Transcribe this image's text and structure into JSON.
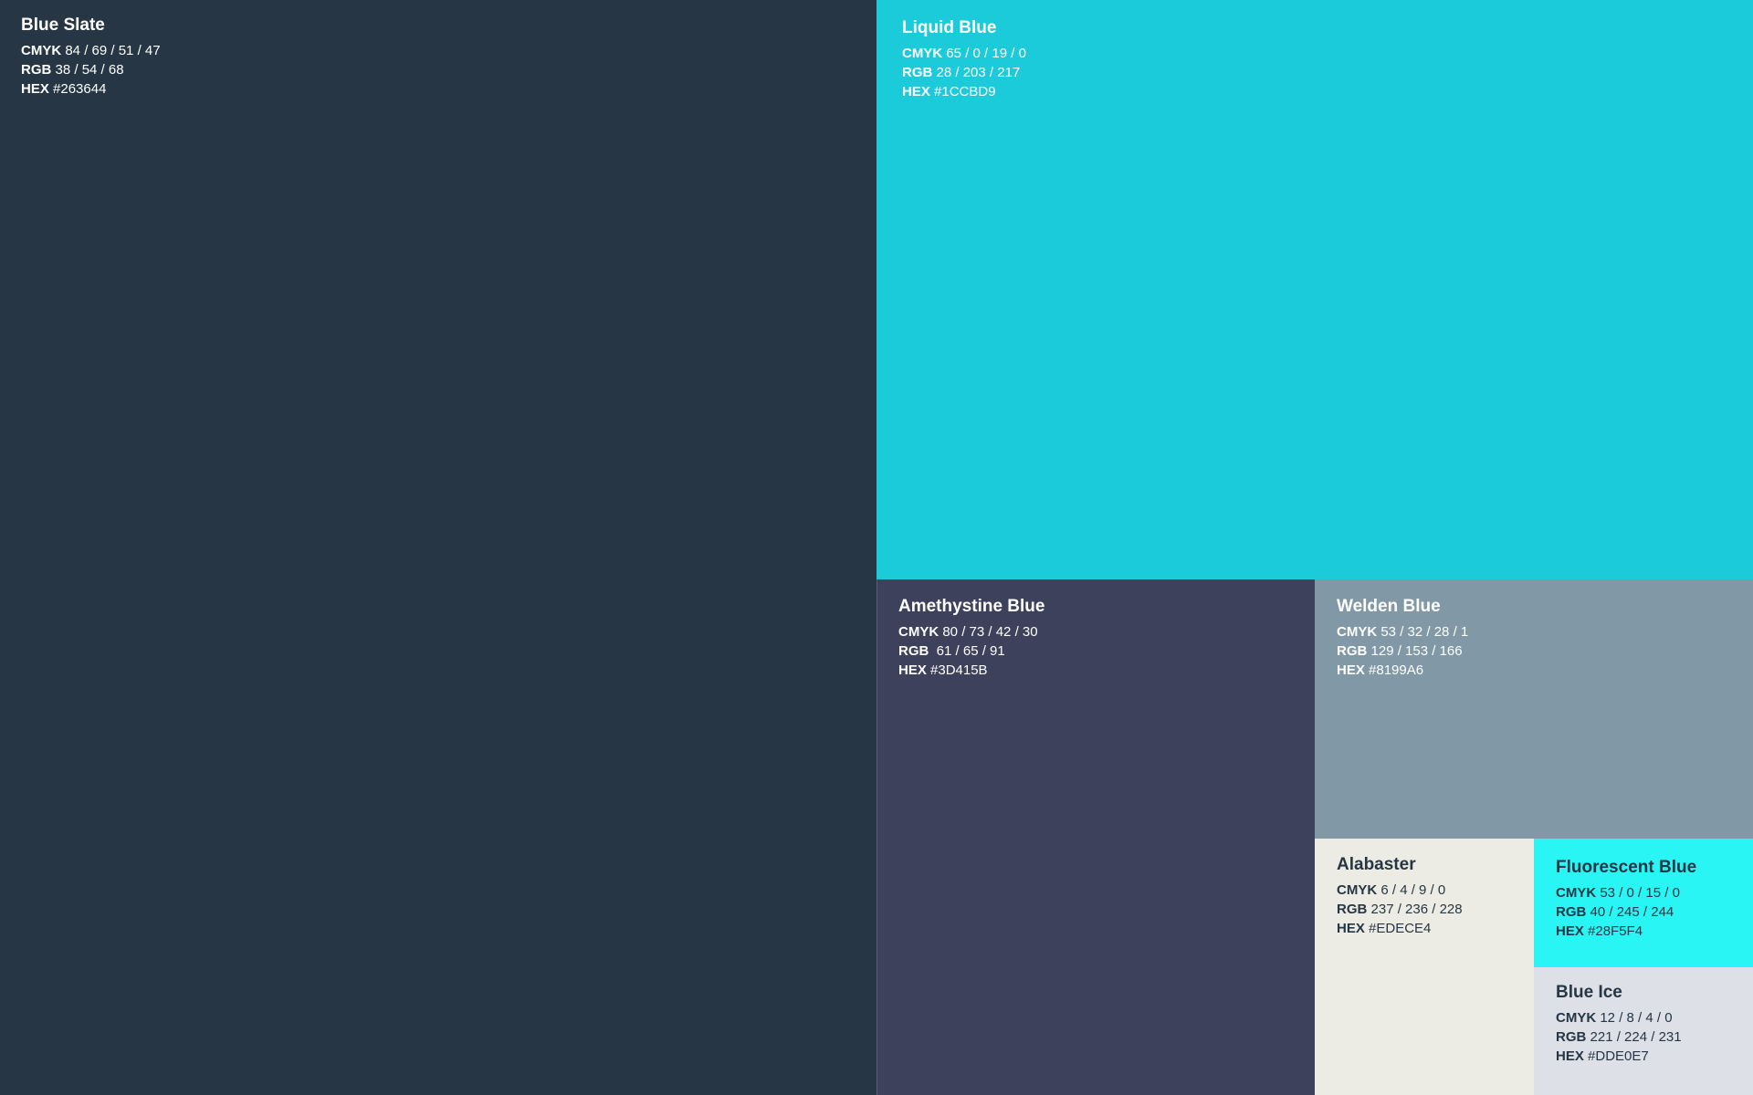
{
  "labels": {
    "cmyk": "CMYK",
    "rgb": "RGB",
    "hex": "HEX"
  },
  "swatches": [
    {
      "name": "Blue Slate",
      "cmyk": "84 / 69 / 51 / 47",
      "rgb": "38 / 54 / 68",
      "hex": "#263644",
      "color": "#263644",
      "text_color": "#ffffff"
    },
    {
      "name": "Liquid Blue",
      "cmyk": "65 / 0 / 19 / 0",
      "rgb": "28 / 203 / 217",
      "hex": "#1CCBD9",
      "color": "#1CCBD9",
      "text_color": "#ffffff"
    },
    {
      "name": "Amethystine Blue",
      "cmyk": "80 / 73 / 42 / 30",
      "rgb": " 61 / 65 / 91",
      "hex": "#3D415B",
      "color": "#3D415B",
      "text_color": "#ffffff"
    },
    {
      "name": "Welden Blue",
      "cmyk": "53 / 32 / 28 / 1",
      "rgb": "129 / 153 / 166",
      "hex": "#8199A6",
      "color": "#8199A6",
      "text_color": "#ffffff"
    },
    {
      "name": "Alabaster",
      "cmyk": "6 / 4 / 9 / 0",
      "rgb": "237 / 236 / 228",
      "hex": "#EDECE4",
      "color": "#EDECE4",
      "text_color": "#263644"
    },
    {
      "name": "Fluorescent Blue",
      "cmyk": "53 / 0 / 15 / 0",
      "rgb": "40 / 245 / 244",
      "hex": "#28F5F4",
      "color": "#28F5F4",
      "text_color": "#263644"
    },
    {
      "name": "Blue Ice",
      "cmyk": "12 / 8 / 4 / 0",
      "rgb": "221 / 224 / 231",
      "hex": "#DDE0E7",
      "color": "#DDE0E7",
      "text_color": "#263644"
    }
  ]
}
